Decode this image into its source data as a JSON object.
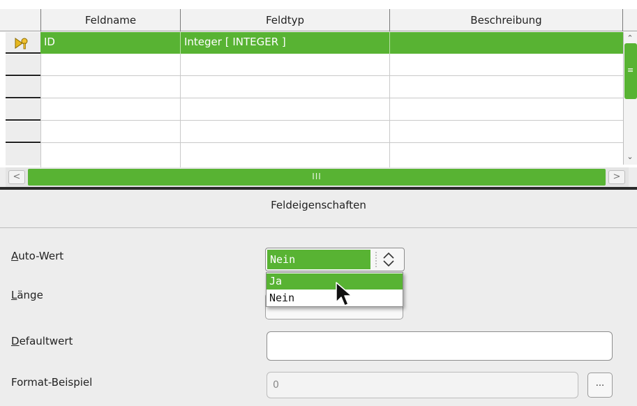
{
  "table": {
    "columns": [
      "Feldname",
      "Feldtyp",
      "Beschreibung"
    ],
    "rows": [
      {
        "name": "ID",
        "type": "Integer [ INTEGER ]",
        "description": ""
      }
    ],
    "primary_key_icon": "primary-key-icon",
    "hscroll_grip": "III"
  },
  "properties": {
    "title": "Feldeigenschaften",
    "auto_wert": {
      "label_u": "A",
      "label_rest": "uto-Wert",
      "value": "Nein",
      "options": [
        "Ja",
        "Nein"
      ],
      "highlighted_option": "Ja"
    },
    "laenge": {
      "label_u": "L",
      "label_rest": "änge"
    },
    "defaultwert": {
      "label_u": "D",
      "label_rest": "efaultwert",
      "value": ""
    },
    "format_beispiel": {
      "label": "Format-Beispiel",
      "value": "0",
      "button": "..."
    }
  },
  "colors": {
    "accent": "#58b333",
    "background": "#ededed"
  }
}
